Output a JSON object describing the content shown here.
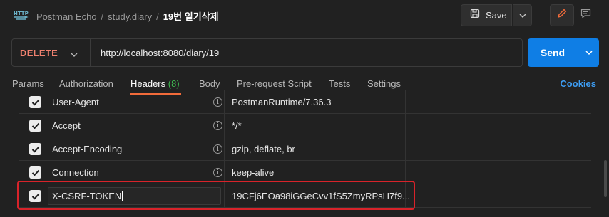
{
  "breadcrumb": {
    "workspace": "Postman Echo",
    "collection": "study.diary",
    "request": "19번 일기삭제",
    "separator": "/"
  },
  "toolbar": {
    "save_label": "Save"
  },
  "request": {
    "method": "DELETE",
    "url": "http://localhost:8080/diary/19",
    "send_label": "Send"
  },
  "tabs": [
    {
      "label": "Params"
    },
    {
      "label": "Authorization"
    },
    {
      "label": "Headers",
      "count": "(8)",
      "active": true
    },
    {
      "label": "Body"
    },
    {
      "label": "Pre-request Script"
    },
    {
      "label": "Tests"
    },
    {
      "label": "Settings"
    }
  ],
  "cookies_label": "Cookies",
  "headers": [
    {
      "key": "User-Agent",
      "value": "PostmanRuntime/7.36.3",
      "checked": true
    },
    {
      "key": "Accept",
      "value": "*/*",
      "checked": true
    },
    {
      "key": "Accept-Encoding",
      "value": "gzip, deflate, br",
      "checked": true
    },
    {
      "key": "Connection",
      "value": "keep-alive",
      "checked": true
    },
    {
      "key": "X-CSRF-TOKEN",
      "value": "19CFj6EOa98iGGeCvv1fS5ZmyRPsH7f9...",
      "checked": true
    }
  ],
  "icons": {
    "app": "http-icon",
    "save": "save-icon",
    "edit": "pencil-icon",
    "comment": "comment-icon",
    "info": "info-icon",
    "check": "checkmark-icon"
  },
  "colors": {
    "accent": "#f26b3a",
    "send": "#0f7ee5",
    "method_delete": "#f0816f",
    "count_green": "#3fb950",
    "highlight": "#d8232a",
    "link": "#3d9bf0"
  }
}
